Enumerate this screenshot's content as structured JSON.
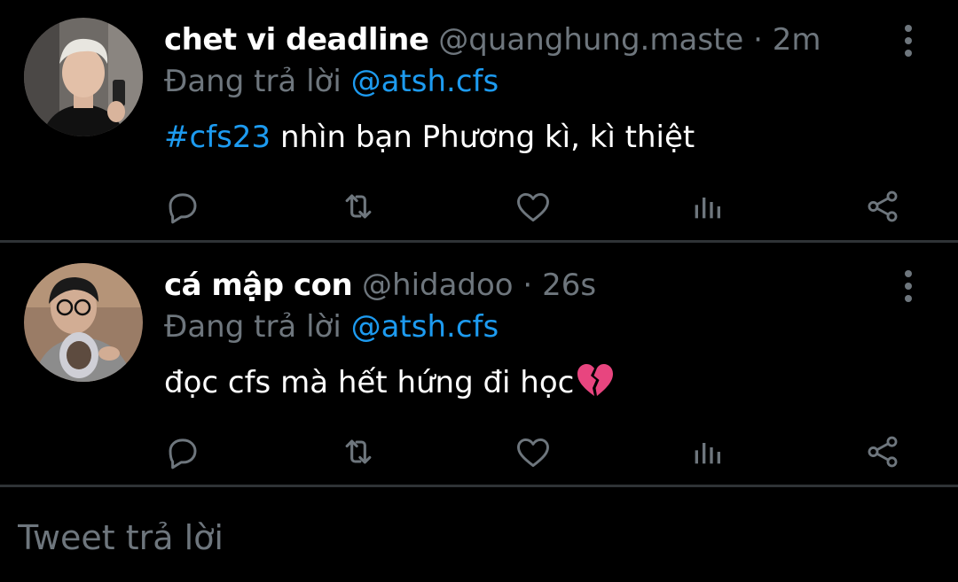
{
  "colors": {
    "background": "#000000",
    "text": "#ffffff",
    "muted": "#6e767d",
    "accent": "#1d9bf0",
    "divider": "#2f3336"
  },
  "tweets": [
    {
      "display_name": "chet vi deadline",
      "handle": "@quanghung.maste",
      "separator": " · ",
      "time": "2m",
      "reply_prefix": "Đang trả lời ",
      "reply_to": "@atsh.cfs",
      "hashtag": "#cfs23",
      "text": " nhìn bạn Phương kì, kì thiệt",
      "icons": [
        "reply-icon",
        "retweet-icon",
        "like-icon",
        "views-icon",
        "share-icon",
        "more-options-icon"
      ]
    },
    {
      "display_name": "cá mập con",
      "handle": "@hidadoo",
      "separator": " · ",
      "time": "26s",
      "reply_prefix": "Đang trả lời ",
      "reply_to": "@atsh.cfs",
      "text": "đọc cfs mà hết hứng đi học",
      "emoji": "broken-heart-icon",
      "icons": [
        "reply-icon",
        "retweet-icon",
        "like-icon",
        "views-icon",
        "share-icon",
        "more-options-icon"
      ]
    }
  ],
  "reply_box": {
    "placeholder": "Tweet trả lời"
  }
}
